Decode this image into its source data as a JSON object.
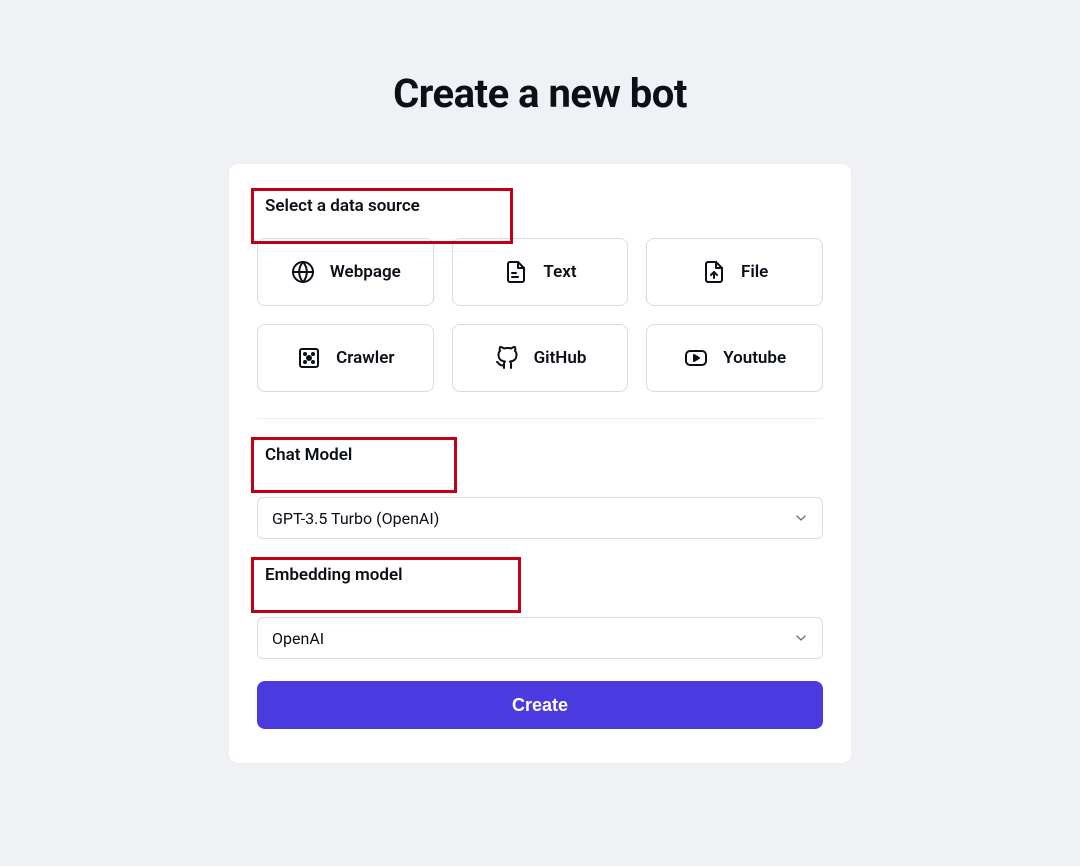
{
  "title": "Create a new bot",
  "labels": {
    "data_source": "Select a data source",
    "chat_model": "Chat Model",
    "embedding_model": "Embedding model"
  },
  "sources": {
    "webpage": "Webpage",
    "text": "Text",
    "file": "File",
    "crawler": "Crawler",
    "github": "GitHub",
    "youtube": "Youtube"
  },
  "chat_model_value": "GPT-3.5 Turbo (OpenAI)",
  "embedding_model_value": "OpenAI",
  "buttons": {
    "create": "Create"
  },
  "colors": {
    "accent": "#4b3ae0",
    "highlight": "#c20015"
  }
}
